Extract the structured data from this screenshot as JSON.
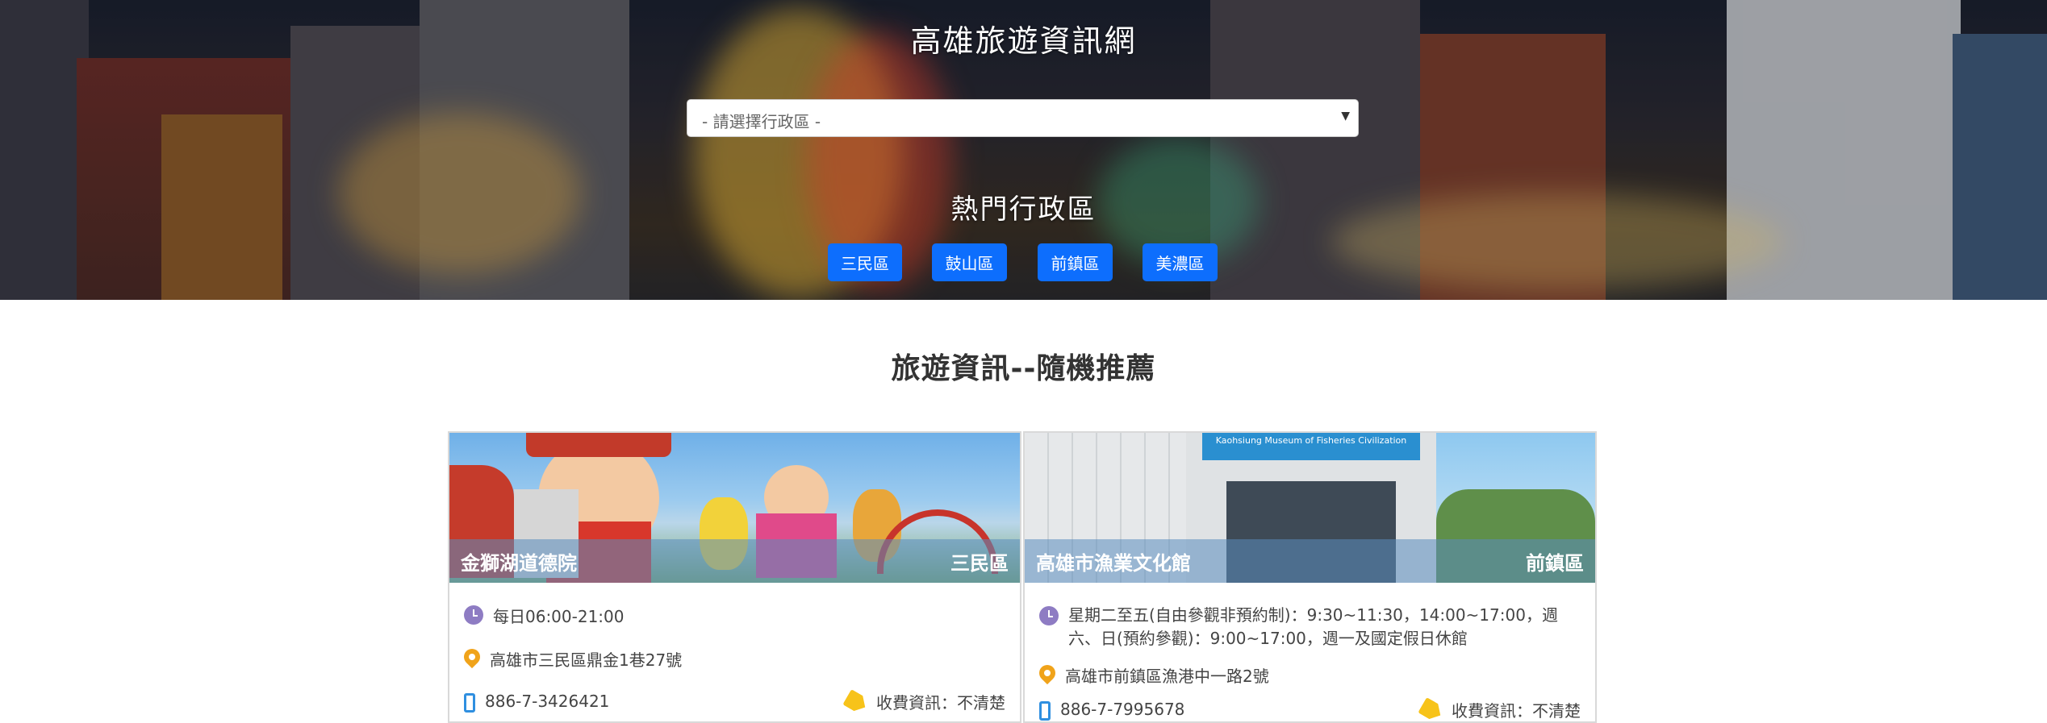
{
  "site": {
    "title": "高雄旅遊資訊網"
  },
  "search": {
    "district_select_placeholder": "- 請選擇行政區 -"
  },
  "hot": {
    "title": "熱門行政區",
    "districts": [
      "三民區",
      "鼓山區",
      "前鎮區",
      "美濃區"
    ],
    "button_color": "#0d6efd"
  },
  "section": {
    "title": "旅遊資訊--隨機推薦"
  },
  "cards": [
    {
      "name": "金獅湖道德院",
      "district": "三民區",
      "hours": "每日06:00-21:00",
      "address": "高雄市三民區鼎金1巷27號",
      "phone": "886-7-3426421",
      "fee": "收費資訊：不清楚"
    },
    {
      "name": "高雄市漁業文化館",
      "district": "前鎮區",
      "hours": "星期二至五(自由參觀非預約制)：9:30~11:30，14:00~17:00，週六、日(預約參觀)：9:00~17:00，週一及國定假日休館",
      "address": "高雄市前鎮區漁港中一路2號",
      "phone": "886-7-7995678",
      "fee": "收費資訊：不清楚",
      "photo_sign_text": "Kaohsiung Museum of Fisheries Civilization"
    }
  ],
  "icons": {
    "clock": "clock-icon",
    "pin": "map-pin-icon",
    "phone": "phone-icon",
    "tag": "price-tag-icon"
  }
}
